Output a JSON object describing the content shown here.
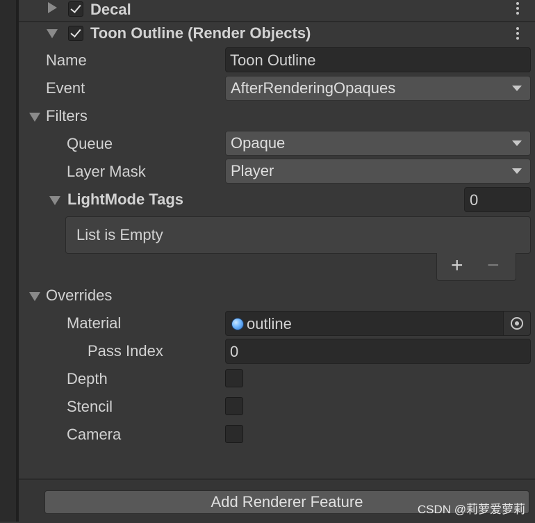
{
  "header": {
    "decal_label": "Decal",
    "feature_title": "Toon Outline (Render Objects)"
  },
  "fields": {
    "name_label": "Name",
    "name_value": "Toon Outline",
    "event_label": "Event",
    "event_value": "AfterRenderingOpaques"
  },
  "filters": {
    "title": "Filters",
    "queue_label": "Queue",
    "queue_value": "Opaque",
    "layer_mask_label": "Layer Mask",
    "layer_mask_value": "Player",
    "lightmode_label": "LightMode Tags",
    "lightmode_count": "0",
    "list_empty_text": "List is Empty",
    "add_symbol": "+",
    "remove_symbol": "−"
  },
  "overrides": {
    "title": "Overrides",
    "material_label": "Material",
    "material_value": "outline",
    "pass_index_label": "Pass Index",
    "pass_index_value": "0",
    "depth_label": "Depth",
    "stencil_label": "Stencil",
    "camera_label": "Camera"
  },
  "footer": {
    "add_button_label": "Add Renderer Feature",
    "watermark": "CSDN @莉萝爱萝莉"
  }
}
